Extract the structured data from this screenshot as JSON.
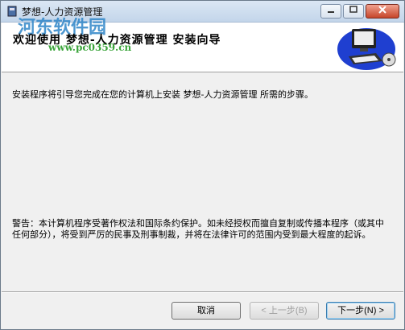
{
  "window": {
    "title": "梦想-人力资源管理",
    "minimize_glyph": "0",
    "maximize_glyph": "1",
    "close_glyph": "r"
  },
  "banner": {
    "heading": "欢迎使用 梦想-人力资源管理 安装向导",
    "watermark_text": "河东软件园",
    "watermark_url": "www.pc0359.cn",
    "icon": "computer-icon"
  },
  "content": {
    "intro": "安装程序将引导您完成在您的计算机上安装 梦想-人力资源管理 所需的步骤。",
    "legal": "警告：本计算机程序受著作权法和国际条约保护。如未经授权而擅自复制或传播本程序（或其中任何部分），将受到严厉的民事及刑事制裁，并将在法律许可的范围内受到最大程度的起诉。"
  },
  "buttons": {
    "cancel": "取消",
    "back": "< 上一步(B)",
    "next": "下一步(N) >"
  }
}
